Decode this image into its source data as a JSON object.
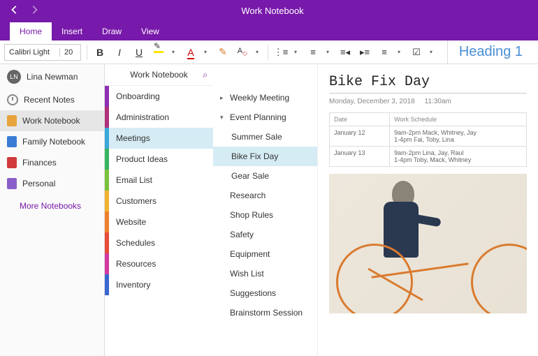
{
  "app": {
    "title": "Work Notebook"
  },
  "tabs": {
    "home": "Home",
    "insert": "Insert",
    "draw": "Draw",
    "view": "View"
  },
  "toolbar": {
    "font_name": "Calibri Light",
    "font_size": "20",
    "heading_style": "Heading 1"
  },
  "user": {
    "initials": "LN",
    "name": "Lina Newman"
  },
  "sidebar": {
    "recent": "Recent Notes",
    "notebooks": [
      {
        "label": "Work Notebook",
        "color": "#e8a33d",
        "active": true
      },
      {
        "label": "Family Notebook",
        "color": "#3a7bd5",
        "active": false
      },
      {
        "label": "Finances",
        "color": "#d13a3a",
        "active": false
      },
      {
        "label": "Personal",
        "color": "#8a5fc9",
        "active": false
      }
    ],
    "more": "More Notebooks"
  },
  "notebook_header": "Work Notebook",
  "sections": [
    {
      "label": "Onboarding",
      "color": "#8e2fb3"
    },
    {
      "label": "Administration",
      "color": "#b0317a"
    },
    {
      "label": "Meetings",
      "color": "#3aa8d8",
      "selected": true
    },
    {
      "label": "Product Ideas",
      "color": "#38b560"
    },
    {
      "label": "Email List",
      "color": "#7bc23c"
    },
    {
      "label": "Customers",
      "color": "#f0b32f"
    },
    {
      "label": "Website",
      "color": "#ef7f2e"
    },
    {
      "label": "Schedules",
      "color": "#e84b3a"
    },
    {
      "label": "Resources",
      "color": "#d13aa0"
    },
    {
      "label": "Inventory",
      "color": "#3a66d1"
    }
  ],
  "pages": [
    {
      "label": "Weekly Meeting",
      "level": 0,
      "expand": "right"
    },
    {
      "label": "Event Planning",
      "level": 0,
      "expand": "down"
    },
    {
      "label": "Summer Sale",
      "level": 1
    },
    {
      "label": "Bike Fix Day",
      "level": 1,
      "selected": true
    },
    {
      "label": "Gear Sale",
      "level": 1
    },
    {
      "label": "Research",
      "level": 0
    },
    {
      "label": "Shop Rules",
      "level": 0
    },
    {
      "label": "Safety",
      "level": 0
    },
    {
      "label": "Equipment",
      "level": 0
    },
    {
      "label": "Wish List",
      "level": 0
    },
    {
      "label": "Suggestions",
      "level": 0
    },
    {
      "label": "Brainstorm Session",
      "level": 0
    }
  ],
  "page": {
    "title": "Bike Fix Day",
    "date": "Monday, December 3, 2018",
    "time": "11:30am",
    "table": {
      "headers": [
        "Date",
        "Work Schedule"
      ],
      "rows": [
        [
          "January 12",
          "9am-2pm Mack, Whitney, Jay\n1-4pm Fai, Toby, Lina"
        ],
        [
          "January 13",
          "9am-2pm Lina, Jay, Raul\n1-4pm Toby, Mack, Whitney"
        ]
      ]
    }
  }
}
